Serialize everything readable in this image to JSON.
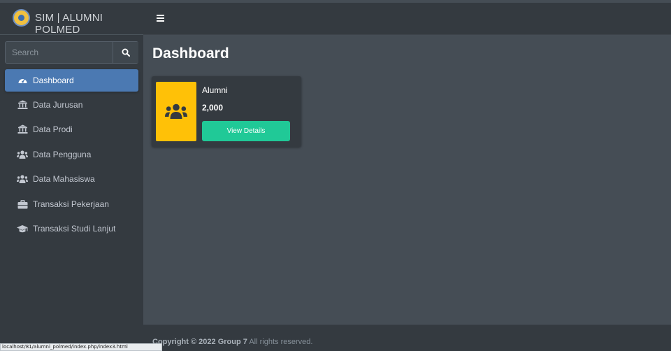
{
  "brand": {
    "title": "SIM | ALUMNI POLMED"
  },
  "search": {
    "placeholder": "Search"
  },
  "sidebar": {
    "items": [
      {
        "label": "Dashboard",
        "icon": "tachometer-icon",
        "active": true
      },
      {
        "label": "Data Jurusan",
        "icon": "university-icon"
      },
      {
        "label": "Data Prodi",
        "icon": "university-icon"
      },
      {
        "label": "Data Pengguna",
        "icon": "users-icon"
      },
      {
        "label": "Data Mahasiswa",
        "icon": "users-icon"
      },
      {
        "label": "Transaksi Pekerjaan",
        "icon": "briefcase-icon"
      },
      {
        "label": "Transaksi Studi Lanjut",
        "icon": "graduation-cap-icon"
      }
    ]
  },
  "main": {
    "title": "Dashboard",
    "card": {
      "title": "Alumni",
      "value": "2,000",
      "button": "View Details",
      "icon": "users-icon"
    }
  },
  "footer": {
    "prefix": "Copyright © 2022",
    "team": "Group 7",
    "suffix": "All rights reserved."
  },
  "status": {
    "url": "localhost/81/alumni_polmed/index.php/index3.html"
  },
  "colors": {
    "sidebar": "#343a40",
    "content": "#454d55",
    "active": "#4b79b2",
    "card_icon": "#ffc107",
    "button": "#20c997"
  }
}
